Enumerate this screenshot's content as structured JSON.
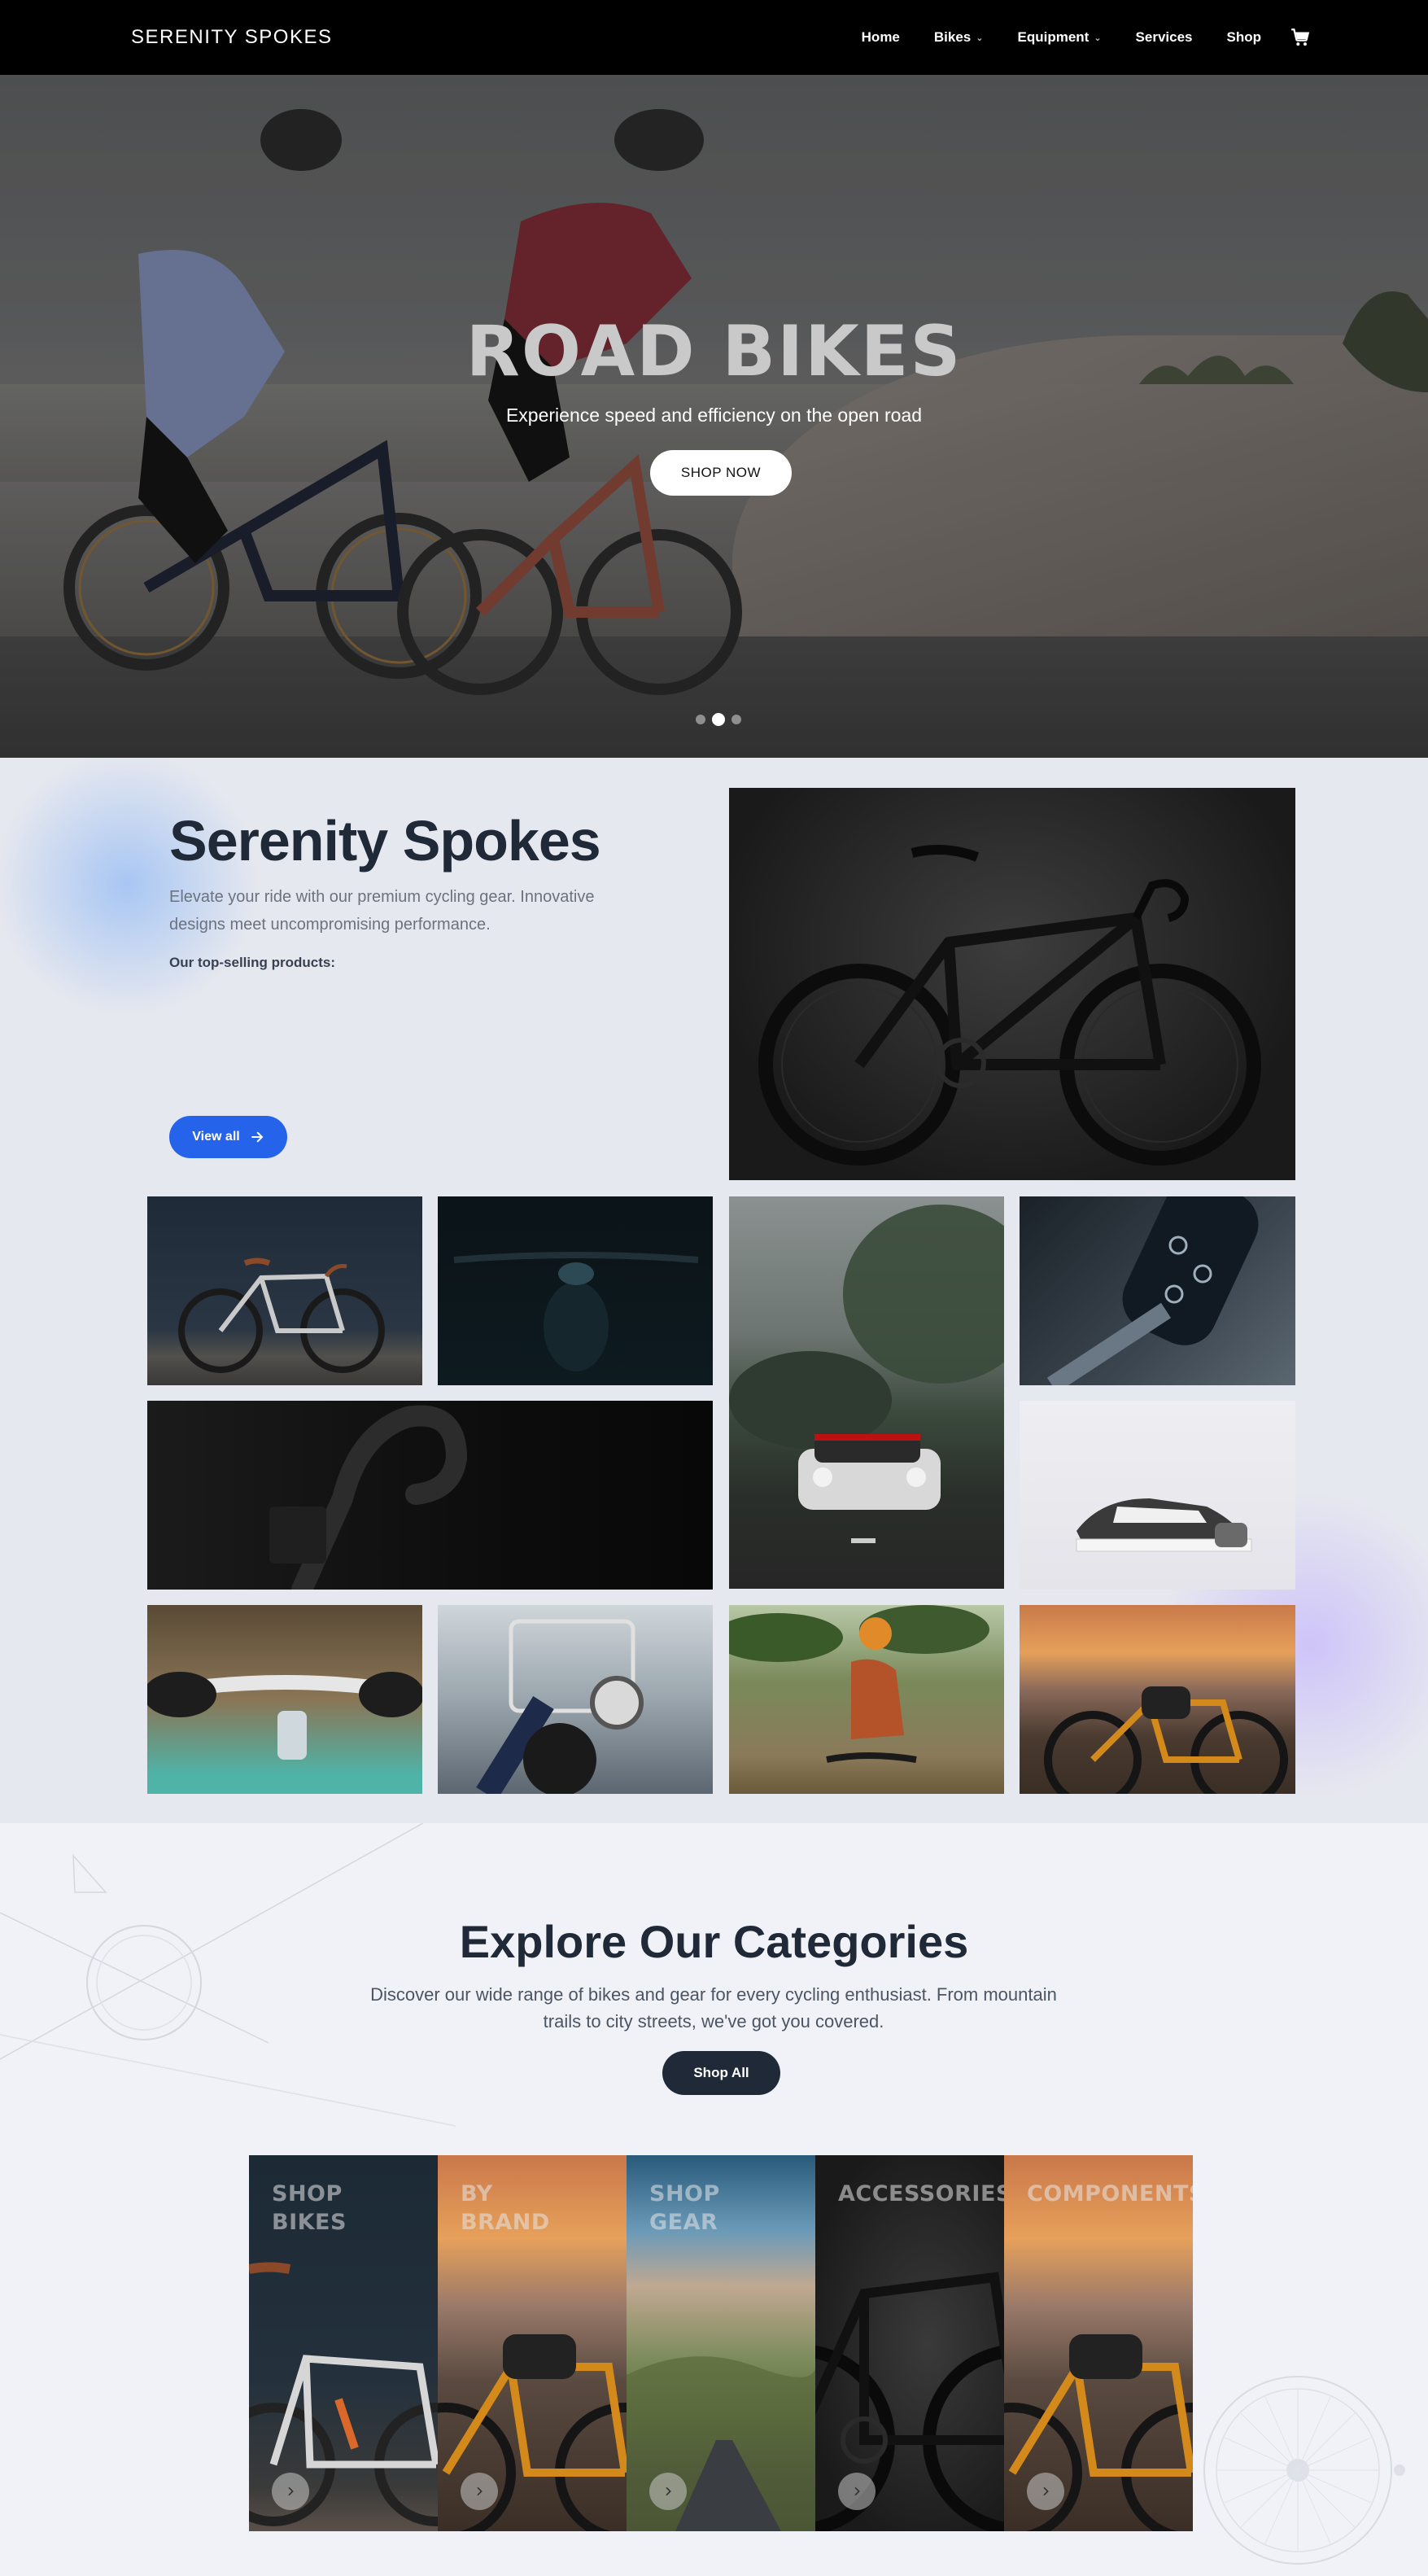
{
  "nav": {
    "brand": "SERENITY SPOKES",
    "links": [
      {
        "label": "Home",
        "dropdown": false
      },
      {
        "label": "Bikes",
        "dropdown": true
      },
      {
        "label": "Equipment",
        "dropdown": true
      },
      {
        "label": "Services",
        "dropdown": false
      },
      {
        "label": "Shop",
        "dropdown": false
      }
    ],
    "cart_icon": "cart-icon"
  },
  "hero": {
    "title": "ROAD BIKES",
    "subtitle": "Experience speed and efficiency on the open road",
    "button": "SHOP NOW",
    "slides_total": 3,
    "active_slide": 2
  },
  "about": {
    "title": "Serenity Spokes",
    "description": "Elevate your ride with our premium cycling gear. Innovative designs meet uncompromising performance.",
    "top_selling_label": "Our top-selling products:",
    "view_all_label": "View all",
    "view_all_icon": "arrow-right-icon"
  },
  "categories": {
    "title": "Explore Our Categories",
    "description": "Discover our wide range of bikes and gear for every cycling enthusiast. From mountain trails to city streets, we've got you covered.",
    "shop_all_label": "Shop All",
    "cards": [
      {
        "label": "SHOP BIKES",
        "line1": "SHOP",
        "line2": "BIKES"
      },
      {
        "label": "BY BRAND",
        "line1": "BY",
        "line2": "BRAND"
      },
      {
        "label": "SHOP GEAR",
        "line1": "SHOP",
        "line2": "GEAR"
      },
      {
        "label": "ACCESSORIES",
        "line1": "ACCESSORIES",
        "line2": ""
      },
      {
        "label": "COMPONENTS",
        "line1": "COMPONENTS",
        "line2": ""
      }
    ]
  },
  "colors": {
    "nav_bg": "#000000",
    "primary_blue": "#2563eb",
    "dark_button": "#1f2937",
    "section_bg": "#e6e8ef"
  }
}
